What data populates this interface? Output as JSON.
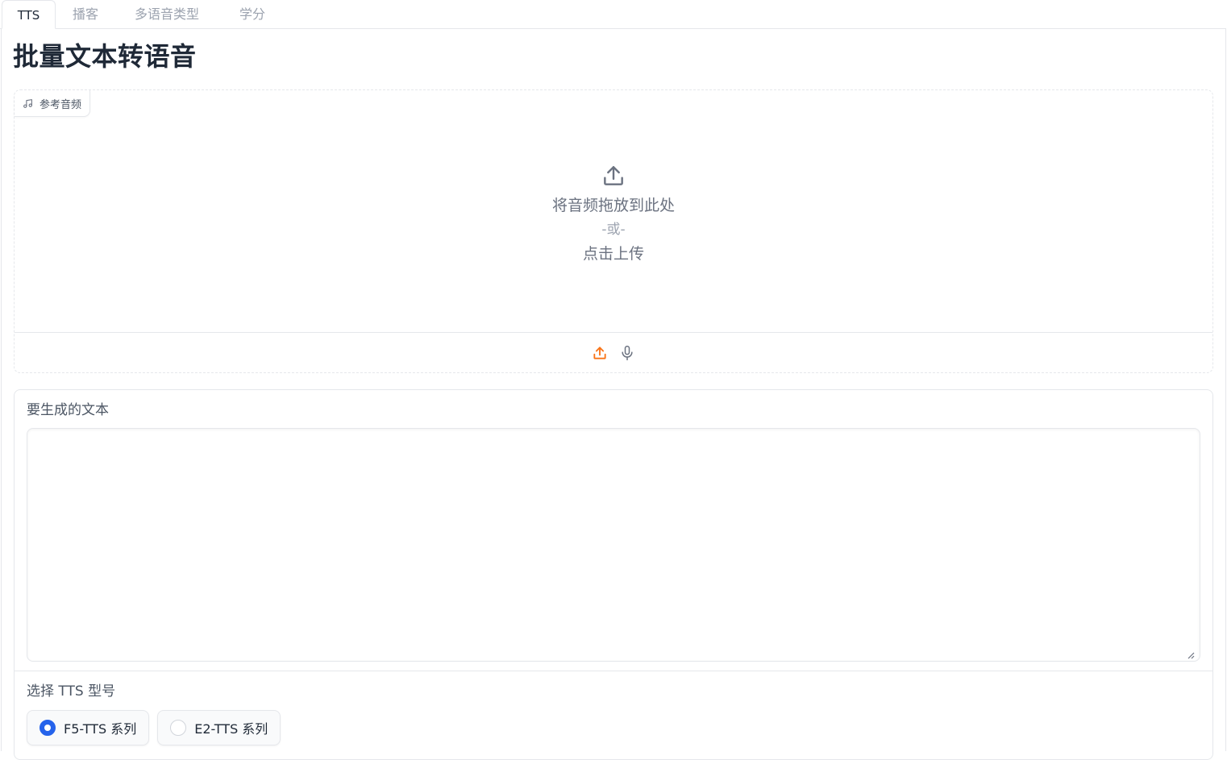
{
  "tabs": [
    {
      "label": "TTS",
      "active": true
    },
    {
      "label": "播客",
      "active": false
    },
    {
      "label": "多语音类型",
      "active": false
    },
    {
      "label": "学分",
      "active": false
    }
  ],
  "page_title": "批量文本转语音",
  "audio": {
    "label": "参考音频",
    "drop_text": "将音频拖放到此处",
    "or_text": "-或-",
    "click_text": "点击上传",
    "upload_icon": "upload-icon",
    "mic_icon": "microphone-icon",
    "accent_color": "#f97316"
  },
  "text_input": {
    "label": "要生成的文本",
    "value": ""
  },
  "model": {
    "label": "选择 TTS 型号",
    "options": [
      {
        "label": "F5-TTS 系列",
        "selected": true
      },
      {
        "label": "E2-TTS 系列",
        "selected": false
      }
    ],
    "selected_color": "#2563eb"
  }
}
